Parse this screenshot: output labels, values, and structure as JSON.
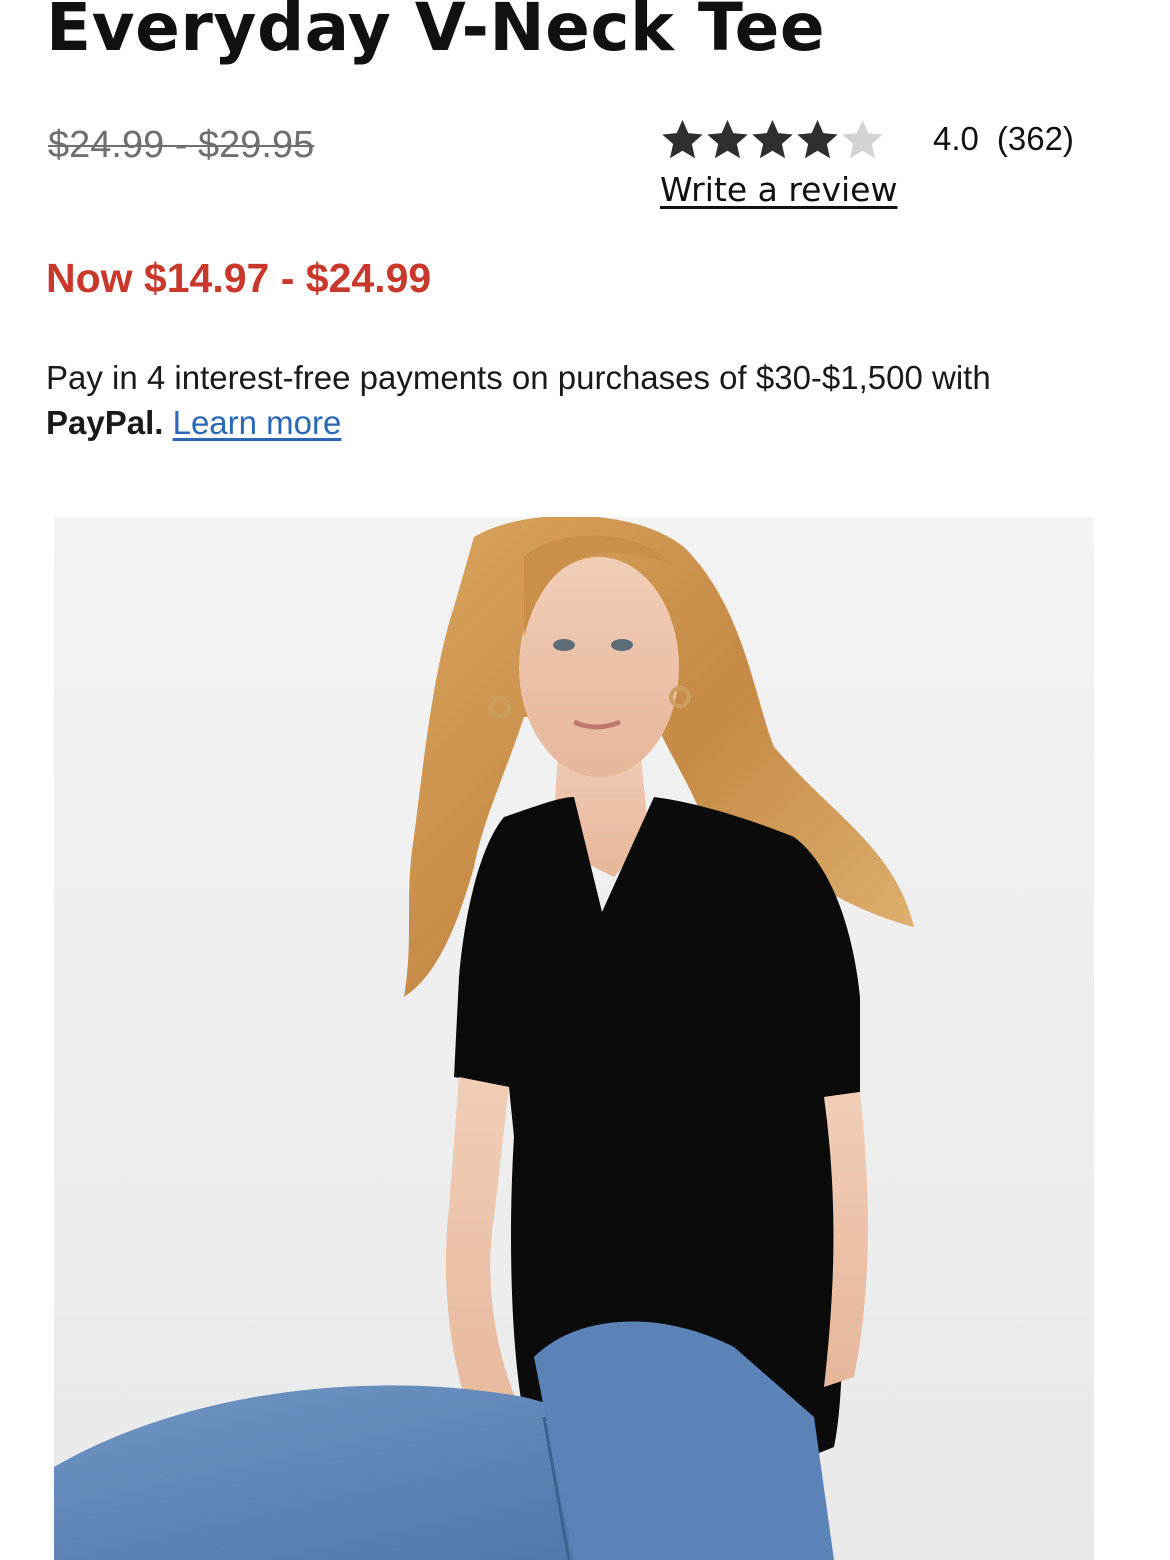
{
  "product": {
    "title": "Everyday V-Neck Tee"
  },
  "pricing": {
    "original": "$24.99 - $29.95",
    "sale": "Now $14.97 - $24.99"
  },
  "rating": {
    "stars": 4,
    "max_stars": 5,
    "value": "4.0",
    "count": "(362)",
    "star_color": "#2f2f2f",
    "empty_star_color": "#d3d3d3"
  },
  "review": {
    "write_label": "Write a review"
  },
  "paypal": {
    "text": "Pay in 4 interest-free payments on purchases of $30-$1,500 with ",
    "brand": "PayPal.",
    "learn_more": "Learn more"
  },
  "colors": {
    "sale_price": "#c8382b",
    "link": "#2b68b3",
    "original_price": "#6f6f6f"
  }
}
